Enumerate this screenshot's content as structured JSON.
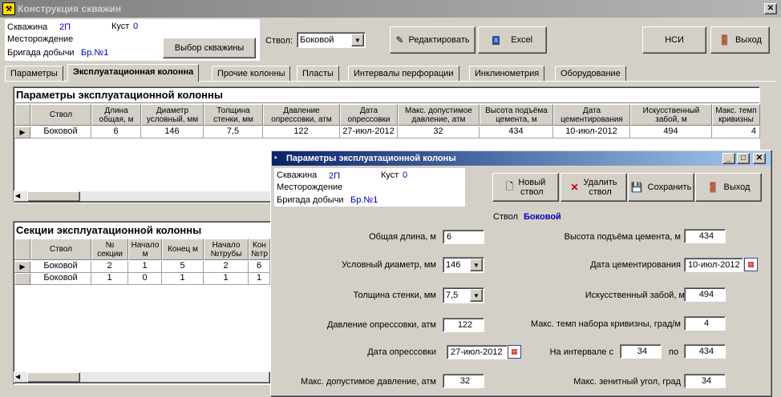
{
  "window": {
    "title": "Конструкция скважин"
  },
  "header": {
    "well_label": "Скважина",
    "well_value": "2П",
    "cluster_label": "Куст",
    "cluster_value": "0",
    "field_label": "Месторождение",
    "brigade_label": "Бригада добычи",
    "brigade_value": "Бр.№1",
    "select_well_btn": "Выбор скважины",
    "trunk_label": "Ствол:",
    "trunk_value": "Боковой",
    "edit_btn": "Редактировать",
    "excel_btn": "Excel",
    "nsi_btn": "НСИ",
    "exit_btn": "Выход"
  },
  "tabs": [
    "Параметры",
    "Эксплуатационная колонна",
    "Прочие колонны",
    "Пласты",
    "Интервалы перфорации",
    "Инклинометрия",
    "Оборудование"
  ],
  "grid1": {
    "title": "Параметры эксплуатационной колонны",
    "headers": [
      "Ствол",
      "Длина\nобщая, м",
      "Диаметр\nусловный, мм",
      "Толщина\nстенки, мм",
      "Давление\nопрессовки, атм",
      "Дата\nопрессовки",
      "Макс. допустимое\nдавление, атм",
      "Высота подъёма\nцемента, м",
      "Дата\nцементирования",
      "Искусственный\nзабой, м",
      "Макс. темп\nкривизны"
    ],
    "row": [
      "Боковой",
      "6",
      "146",
      "7,5",
      "122",
      "27-июл-2012",
      "32",
      "434",
      "10-июл-2012",
      "494",
      "4"
    ]
  },
  "grid2": {
    "title": "Секции эксплуатационной колонны",
    "headers": [
      "Ствол",
      "№\nсекции",
      "Начало\nм",
      "Конец м",
      "Начало\n№трубы",
      "Кон\n№тр"
    ],
    "rows": [
      [
        "Боковой",
        "2",
        "1",
        "5",
        "2",
        "6"
      ],
      [
        "Боковой",
        "1",
        "0",
        "1",
        "1",
        "1"
      ]
    ]
  },
  "dialog": {
    "title": "Параметры эксплуатационной колоны",
    "well_label": "Скважина",
    "well_value": "2П",
    "cluster_label": "Куст",
    "cluster_value": "0",
    "field_label": "Месторождение",
    "brigade_label": "Бригада добычи",
    "brigade_value": "Бр.№1",
    "new_btn": "Новый\nствол",
    "delete_btn": "Удалить\nствол",
    "save_btn": "Сохранить",
    "exit_btn": "Выход",
    "trunk_label": "Ствол",
    "trunk_value": "Боковой",
    "total_length_label": "Общая длина, м",
    "total_length": "6",
    "diameter_label": "Условный диаметр, мм",
    "diameter": "146",
    "thickness_label": "Толщина стенки, мм",
    "thickness": "7,5",
    "pressure_label": "Давление опрессовки, атм",
    "pressure": "122",
    "pressure_date_label": "Дата опрессовки",
    "pressure_date": "27-июл-2012",
    "max_pressure_label": "Макс. допустимое давление, атм",
    "max_pressure": "32",
    "cement_height_label": "Высота подъёма цемента, м",
    "cement_height": "434",
    "cement_date_label": "Дата цементирования",
    "cement_date": "10-июл-2012",
    "bottom_label": "Искусственный забой, м",
    "bottom": "494",
    "curv_label": "Макс. темп набора кривизны, град/м",
    "curv": "4",
    "interval_label": "На интервале с",
    "interval_from": "34",
    "interval_to_label": "по",
    "interval_to": "434",
    "zenith_label": "Макс. зенитный угол, град",
    "zenith": "34"
  }
}
